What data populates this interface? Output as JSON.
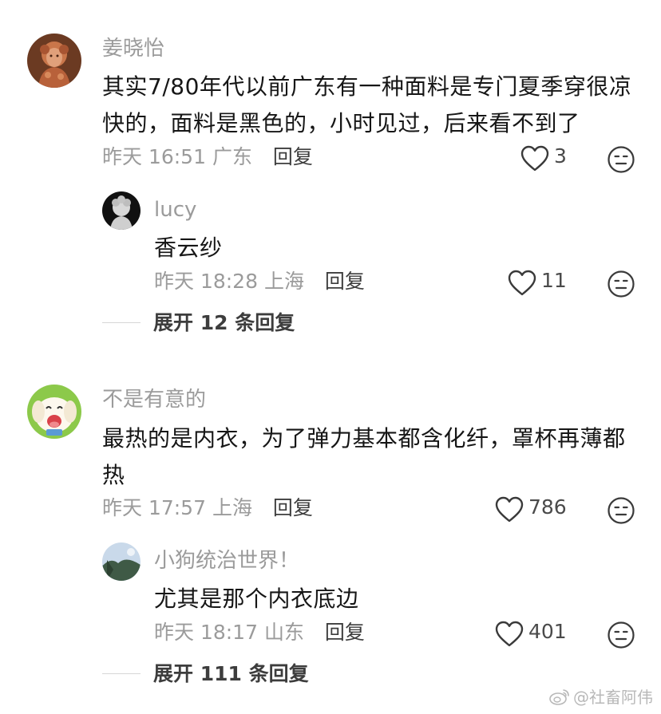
{
  "comments": [
    {
      "username": "姜晓怡",
      "text": "其实7/80年代以前广东有一种面料是专门夏季穿很凉快的，面料是黑色的，小时见过，后来看不到了",
      "time": "昨天 16:51",
      "location": "广东",
      "reply_label": "回复",
      "likes": "3",
      "avatar_icon": "portrait-avatar",
      "replies": [
        {
          "username": "lucy",
          "text": "香云纱",
          "time": "昨天 18:28",
          "location": "上海",
          "reply_label": "回复",
          "likes": "11",
          "avatar_icon": "silhouette-avatar"
        }
      ],
      "expand_label": "展开 12 条回复"
    },
    {
      "username": "不是有意的",
      "text": "最热的是内衣，为了弹力基本都含化纤，罩杯再薄都热",
      "time": "昨天 17:57",
      "location": "上海",
      "reply_label": "回复",
      "likes": "786",
      "avatar_icon": "cartoon-dog-avatar",
      "replies": [
        {
          "username": "小狗统治世界！",
          "text": "尤其是那个内衣底边",
          "time": "昨天 18:17",
          "location": "山东",
          "reply_label": "回复",
          "likes": "401",
          "avatar_icon": "landscape-avatar"
        }
      ],
      "expand_label": "展开 111 条回复"
    }
  ],
  "watermark": {
    "text": "@社畜阿伟",
    "icon": "weibo-logo-icon"
  },
  "colors": {
    "secondary_text": "#9b9b9b",
    "primary_text": "#161616",
    "icon_stroke": "#3a3a3a"
  }
}
